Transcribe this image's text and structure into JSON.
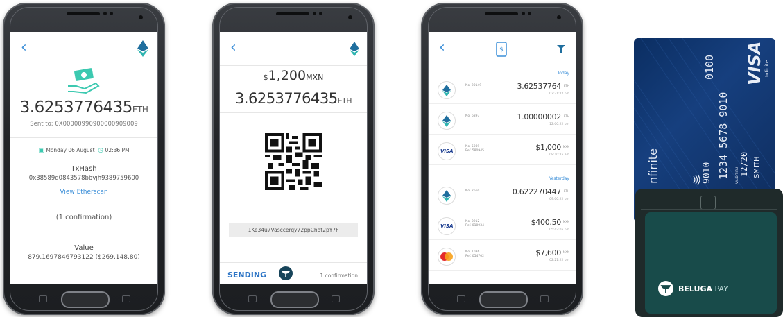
{
  "screen1": {
    "amount": "3.6253776435",
    "unit": "ETH",
    "sent_to": "Sent to: 0X00000990900000909009",
    "date": "Monday 06 August",
    "time": "02:36 PM",
    "txhash_label": "TxHash",
    "txhash": "0x38589q0843578bbvjh9389759600",
    "view_link": "View Etherscan",
    "confirmations": "(1 confirmation)",
    "value_label": "Value",
    "value": "879.1697846793122 ($269,148.80)"
  },
  "screen2": {
    "fiat_symbol": "$",
    "fiat_amount": "1,200",
    "fiat_currency": "MXN",
    "eth_amount": "3.6253776435",
    "eth_unit": "ETH",
    "address": "1Ke34u7Vasccerqy72ppChot2pY7F",
    "sending": "SENDING",
    "confirmation": "1 confirmation"
  },
  "screen3": {
    "today": "Today",
    "yesterday": "Yesterday",
    "transactions": [
      {
        "icon": "eth",
        "no": "No. 20149",
        "ref": "",
        "amount": "3.62537764",
        "cur": "ETH",
        "time": "02:21:22 pm"
      },
      {
        "icon": "eth",
        "no": "No. 6897",
        "ref": "",
        "amount": "1.00000002",
        "cur": "ETH",
        "time": "12:00:22 pm"
      },
      {
        "icon": "visa",
        "no": "No. 5089",
        "ref": "Ref. 580945",
        "amount": "$1,000",
        "cur": "MXN",
        "time": "08:10:15 am"
      },
      {
        "icon": "eth",
        "no": "No. 2660",
        "ref": "",
        "amount": "0.622270447",
        "cur": "ETH",
        "time": "09:00:22 pm"
      },
      {
        "icon": "visa",
        "no": "No. 0912",
        "ref": "Ref. 010934",
        "amount": "$400.50",
        "cur": "MXN",
        "time": "05:42:05 pm"
      },
      {
        "icon": "mastercard",
        "no": "No. 1036",
        "ref": "Ref. 054702",
        "amount": "$7,600",
        "cur": "MXN",
        "time": "02:21:22 pm"
      }
    ]
  },
  "card": {
    "brand": "VISA",
    "tier": "Infinite",
    "digits_top": "0100",
    "digits_mid": "9010",
    "number_line": "1234  5678  9010",
    "valid_label": "VALID THRU",
    "expiry": "12/20",
    "holder": "SMITH",
    "infinite_text": "nfinite"
  },
  "terminal": {
    "brand_bold": "BELUGA",
    "brand_light": "PAY"
  },
  "colors": {
    "accent_blue": "#3c8fd8",
    "teal": "#3cc9b0",
    "visa_blue": "#0b2e62",
    "beluga_teal": "#184b4a"
  }
}
